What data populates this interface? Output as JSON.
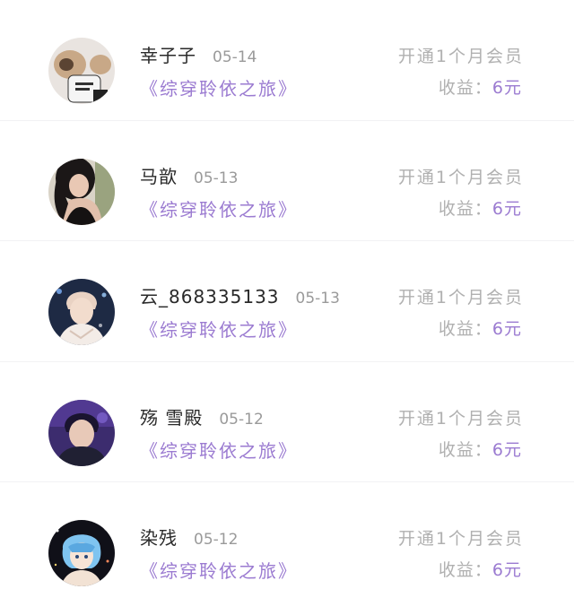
{
  "accent_color": "#9b7bd1",
  "items": [
    {
      "name": "幸子子",
      "date": "05-14",
      "book": "《综穿聆依之旅》",
      "action": "开通1个月会员",
      "income_label": "收益：",
      "income_value": "6元",
      "avatar": "dog-photo-avatar"
    },
    {
      "name": "马歆",
      "date": "05-13",
      "book": "《综穿聆依之旅》",
      "action": "开通1个月会员",
      "income_label": "收益：",
      "income_value": "6元",
      "avatar": "woman-photo-avatar"
    },
    {
      "name": "云_868335133",
      "date": "05-13",
      "book": "《综穿聆依之旅》",
      "action": "开通1个月会员",
      "income_label": "收益：",
      "income_value": "6元",
      "avatar": "singer-photo-avatar"
    },
    {
      "name": "殇 雪殿",
      "date": "05-12",
      "book": "《综穿聆依之旅》",
      "action": "开通1个月会员",
      "income_label": "收益：",
      "income_value": "6元",
      "avatar": "man-purple-photo-avatar"
    },
    {
      "name": "染残",
      "date": "05-12",
      "book": "《综穿聆依之旅》",
      "action": "开通1个月会员",
      "income_label": "收益：",
      "income_value": "6元",
      "avatar": "anime-girl-avatar"
    }
  ]
}
